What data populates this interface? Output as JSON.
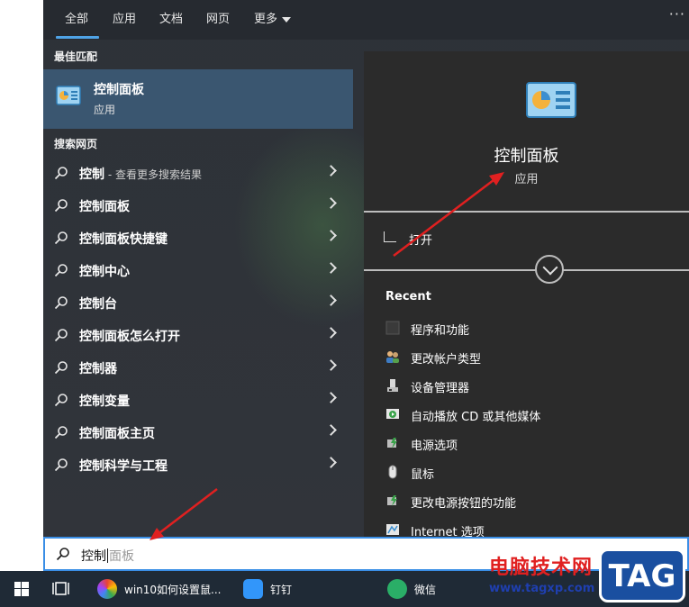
{
  "tabs": [
    {
      "label": "全部"
    },
    {
      "label": "应用"
    },
    {
      "label": "文档"
    },
    {
      "label": "网页"
    },
    {
      "label": "更多"
    }
  ],
  "overflow": "···",
  "best_match": {
    "heading": "最佳匹配",
    "title": "控制面板",
    "subtitle": "应用"
  },
  "web_search": {
    "heading": "搜索网页",
    "results": [
      {
        "label": "控制",
        "hint": " - 查看更多搜索结果"
      },
      {
        "label": "控制面板",
        "hint": ""
      },
      {
        "label": "控制面板快捷键",
        "hint": ""
      },
      {
        "label": "控制中心",
        "hint": ""
      },
      {
        "label": "控制台",
        "hint": ""
      },
      {
        "label": "控制面板怎么打开",
        "hint": ""
      },
      {
        "label": "控制器",
        "hint": ""
      },
      {
        "label": "控制变量",
        "hint": ""
      },
      {
        "label": "控制面板主页",
        "hint": ""
      },
      {
        "label": "控制科学与工程",
        "hint": ""
      }
    ]
  },
  "preview": {
    "title": "控制面板",
    "subtitle": "应用",
    "open_label": "打开",
    "recent_heading": "Recent",
    "recent": [
      {
        "label": "程序和功能",
        "icon": "programs-icon"
      },
      {
        "label": "更改帐户类型",
        "icon": "users-icon"
      },
      {
        "label": "设备管理器",
        "icon": "device-manager-icon"
      },
      {
        "label": "自动播放 CD 或其他媒体",
        "icon": "autoplay-icon"
      },
      {
        "label": "电源选项",
        "icon": "power-icon"
      },
      {
        "label": "鼠标",
        "icon": "mouse-icon"
      },
      {
        "label": "更改电源按钮的功能",
        "icon": "power-button-icon"
      },
      {
        "label": "Internet 选项",
        "icon": "internet-options-icon"
      }
    ]
  },
  "search": {
    "typed": "控制",
    "suggestion": "面板"
  },
  "taskbar": {
    "apps": [
      {
        "label": "win10如何设置鼠...",
        "icon": "browser-icon"
      },
      {
        "label": "钉钉",
        "icon": "dingtalk-icon"
      },
      {
        "label": "微信",
        "icon": "wechat-icon"
      }
    ]
  },
  "watermark": {
    "line1": "电脑技术网",
    "line2": "www.tagxp.com",
    "badge": "TAG"
  },
  "colors": {
    "accent": "#4fa3e6",
    "selected_row": "#3a5670",
    "annotation_arrow": "#e02020"
  }
}
